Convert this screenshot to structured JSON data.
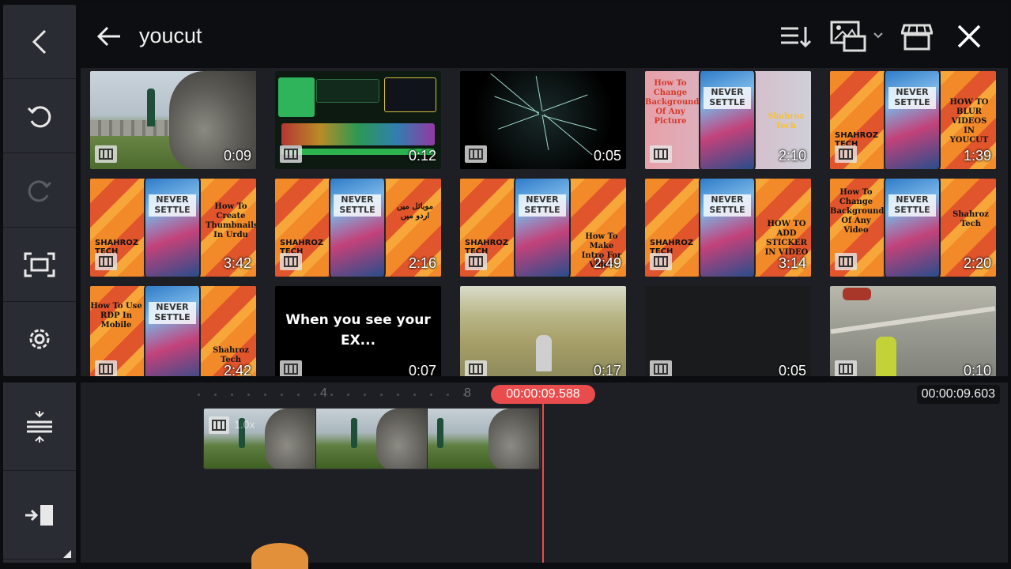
{
  "header": {
    "search_query": "youcut",
    "icons": [
      "back-arrow-icon",
      "sort-icon",
      "media-type-icon",
      "store-icon",
      "close-icon"
    ]
  },
  "sidebar": {
    "top_buttons": [
      "back-icon",
      "undo-icon",
      "redo-icon",
      "fullscreen-icon",
      "settings-icon"
    ],
    "bottom_buttons": [
      "track-align-icon",
      "export-icon"
    ]
  },
  "media": [
    {
      "duration": "0:09",
      "kind": "nature"
    },
    {
      "duration": "0:12",
      "kind": "game"
    },
    {
      "duration": "0:05",
      "kind": "stars"
    },
    {
      "duration": "2:10",
      "kind": "orange",
      "caption": "How To Change Background Of Any Picture",
      "brand": "Shahroz Tech"
    },
    {
      "duration": "1:39",
      "kind": "orange",
      "caption": "HOW TO BLUR VIDEOS IN YOUCUT",
      "brand": "SHAHROZ TECH"
    },
    {
      "duration": "3:42",
      "kind": "orange",
      "caption": "How To Create Thumbnails In Urdu",
      "brand": "SHAHROZ TECH"
    },
    {
      "duration": "2:16",
      "kind": "orange",
      "caption": "موبائل میں اردو میں",
      "brand": "SHAHROZ TECH"
    },
    {
      "duration": "2:49",
      "kind": "orange",
      "caption": "How To Make Intro For Video",
      "brand": "SHAHROZ TECH"
    },
    {
      "duration": "3:14",
      "kind": "orange",
      "caption": "HOW TO ADD STICKER IN VIDEO",
      "brand": "SHAHROZ TECH"
    },
    {
      "duration": "2:20",
      "kind": "orange",
      "caption": "How To Change Background Of Any Video",
      "brand": "Shahroz Tech"
    },
    {
      "duration": "2:42",
      "kind": "orange",
      "caption": "How To Use RDP In Mobile",
      "brand": "Shahroz Tech"
    },
    {
      "duration": "0:07",
      "kind": "black",
      "caption": "When you see your EX..."
    },
    {
      "duration": "0:17",
      "kind": "hill"
    },
    {
      "duration": "0:05",
      "kind": "dark"
    },
    {
      "duration": "0:10",
      "kind": "road"
    }
  ],
  "phone_text": "NEVER SETTLE",
  "timeline": {
    "ruler_marks": [
      "4",
      "8"
    ],
    "playhead_time": "00:00:09.588",
    "total_time": "00:00:09.603",
    "clip_speed": "1.0x"
  },
  "colors": {
    "accent": "#e94c4c",
    "panel": "#2a2c33",
    "background": "#1d1f24"
  }
}
